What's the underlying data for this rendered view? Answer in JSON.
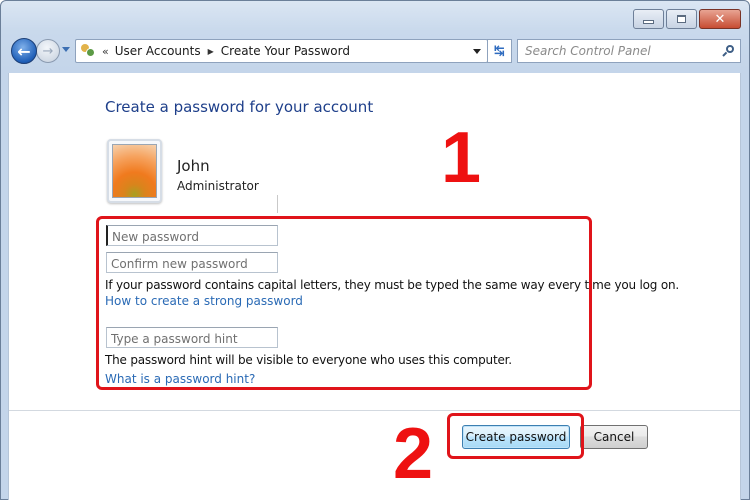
{
  "window": {
    "controls": {
      "minimize": "minimize",
      "maximize": "maximize",
      "close": "close"
    }
  },
  "navbar": {
    "back_icon": "back-arrow-icon",
    "forward_icon": "forward-arrow-icon",
    "address": {
      "overflow": "«",
      "breadcrumbs": [
        "User Accounts",
        "Create Your Password"
      ],
      "separator": "▶"
    },
    "refresh_glyph": "↹",
    "search": {
      "placeholder": "Search Control Panel"
    }
  },
  "main": {
    "title": "Create a password for your account",
    "user": {
      "name": "John",
      "role": "Administrator"
    },
    "fields": {
      "new_password": {
        "placeholder": "New password",
        "value": ""
      },
      "confirm_password": {
        "placeholder": "Confirm new password",
        "value": ""
      },
      "hint": {
        "placeholder": "Type a password hint",
        "value": ""
      }
    },
    "caps_notice": "If your password contains capital letters, they must be typed the same way every time you log on.",
    "strong_password_link": "How to create a strong password",
    "hint_notice": "The password hint will be visible to everyone who uses this computer.",
    "hint_link": "What is a password hint?",
    "buttons": {
      "create": "Create password",
      "cancel": "Cancel"
    }
  },
  "annotations": {
    "step1": "1",
    "step2": "2",
    "color": "#ee1111"
  }
}
